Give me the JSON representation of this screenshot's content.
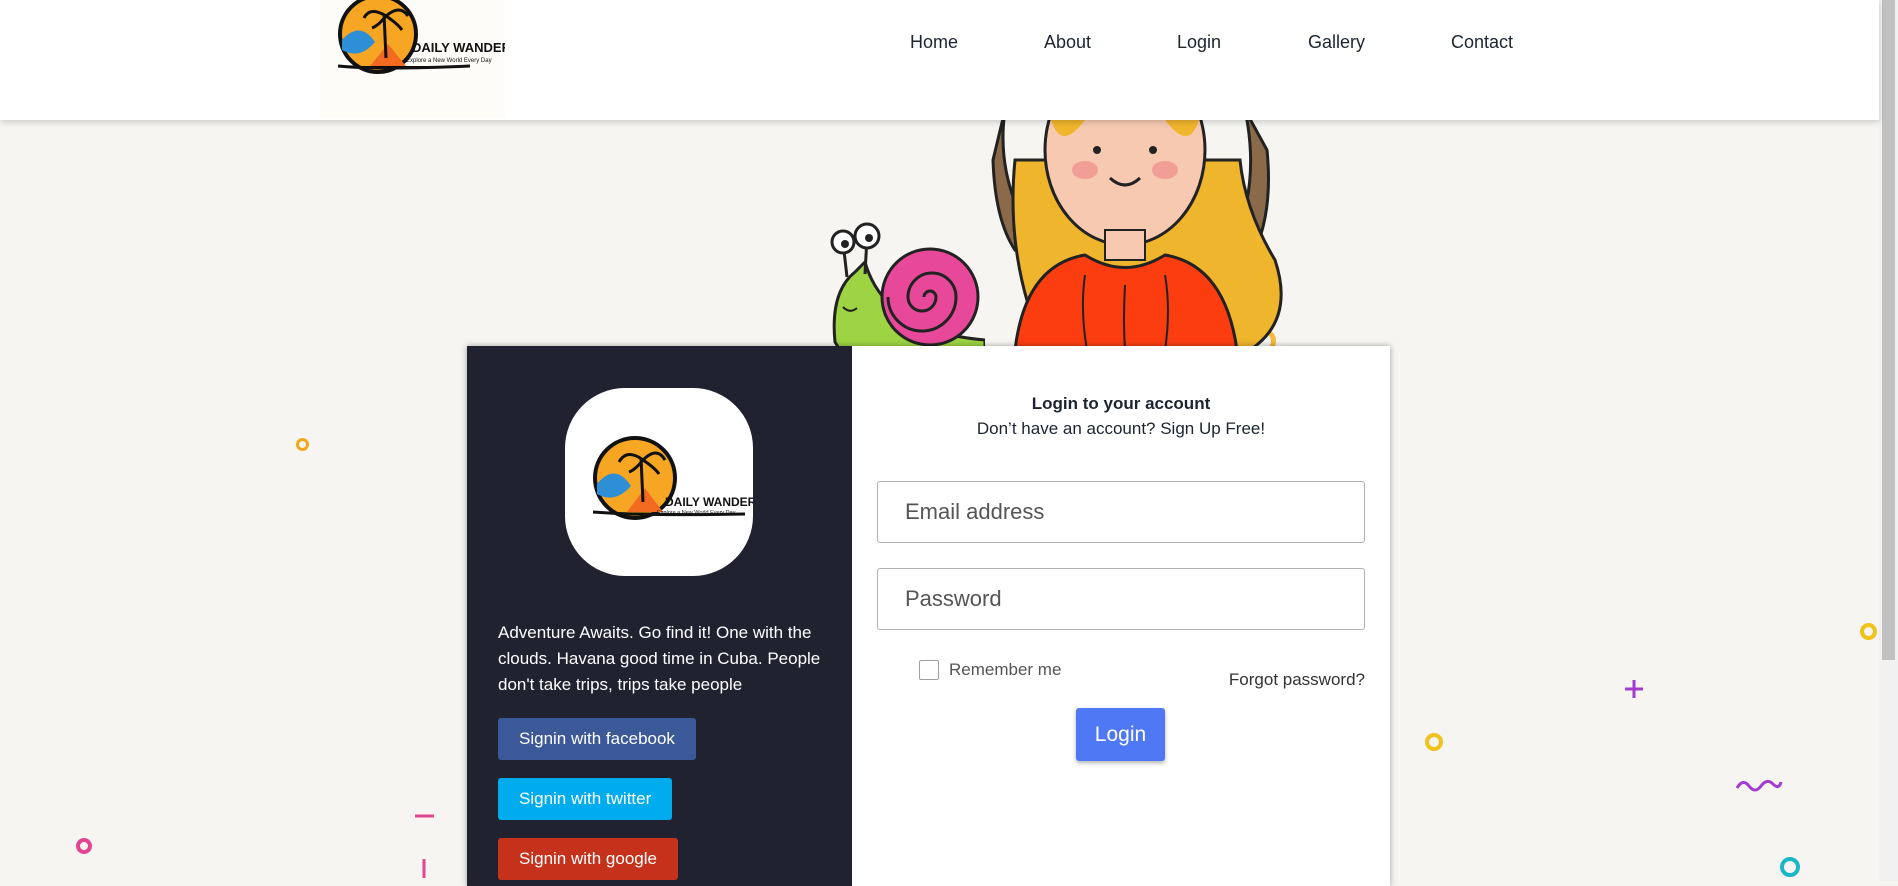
{
  "brand": {
    "name": "DAILY WANDER",
    "tagline": "Explore a New World Every Day"
  },
  "nav": {
    "items": [
      "Home",
      "About",
      "Login",
      "Gallery",
      "Contact"
    ]
  },
  "left_panel": {
    "tagline": "Adventure Awaits. Go find it! One with the clouds. Havana good time in Cuba. People don't take trips, trips take people",
    "facebook_label": "Signin with facebook",
    "twitter_label": "Signin with twitter",
    "google_label": "Signin with google"
  },
  "login_form": {
    "title": "Login to your account",
    "subtitle": "Don’t have an account? Sign Up Free!",
    "email_placeholder": "Email address",
    "password_placeholder": "Password",
    "remember_label": "Remember me",
    "forgot_label": "Forgot password?",
    "submit_label": "Login"
  },
  "colors": {
    "facebook": "#3b5998",
    "twitter": "#00acee",
    "google": "#c5311a",
    "login_button": "#4f78f5",
    "panel_dark": "#202230"
  }
}
